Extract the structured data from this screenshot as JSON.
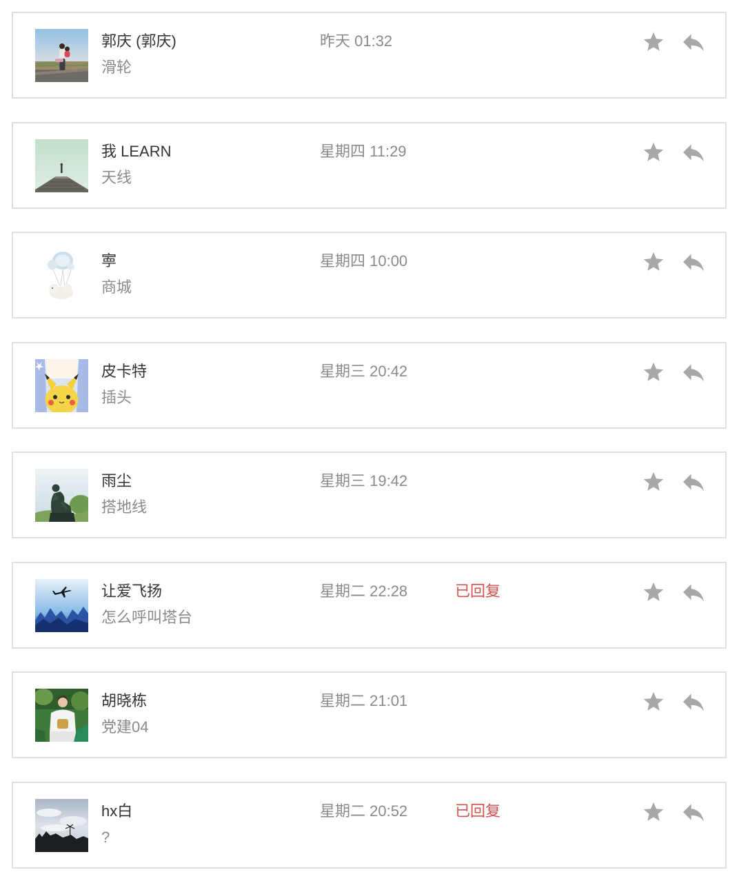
{
  "colors": {
    "name": "#333333",
    "meta": "#8a8a8a",
    "replied": "#d35050",
    "icon": "#a8a8a8",
    "border": "#dfdfdf"
  },
  "actions": {
    "star_icon": "star-icon",
    "reply_icon": "reply-icon"
  },
  "messages": [
    {
      "name": "郭庆 (郭庆)",
      "time": "昨天 01:32",
      "content": "滑轮"
    },
    {
      "name": "我 LEARN",
      "time": "星期四 11:29",
      "content": "天线"
    },
    {
      "name": "寕",
      "time": "星期四 10:00",
      "content": "商城"
    },
    {
      "name": "皮卡特",
      "time": "星期三 20:42",
      "content": "插头"
    },
    {
      "name": "雨尘",
      "time": "星期三 19:42",
      "content": "搭地线"
    },
    {
      "name": "让爱飞扬",
      "time": "星期二 22:28",
      "status": "已回复",
      "content": "怎么呼叫塔台"
    },
    {
      "name": "胡晓栋",
      "time": "星期二 21:01",
      "content": "党建04"
    },
    {
      "name": "hx白",
      "time": "星期二 20:52",
      "status": "已回复",
      "content": "?"
    }
  ]
}
